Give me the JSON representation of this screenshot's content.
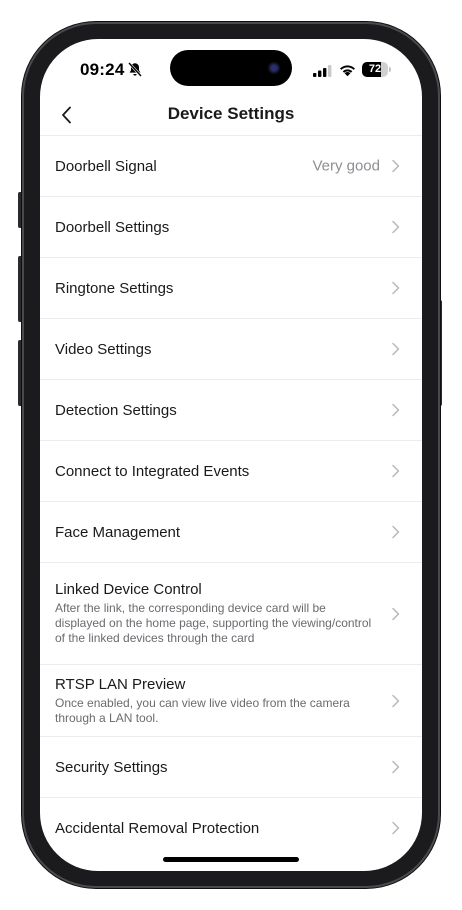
{
  "status_bar": {
    "time": "09:24",
    "battery_level": "72",
    "battery_fraction": 0.72
  },
  "header": {
    "title": "Device Settings"
  },
  "settings": [
    {
      "id": "doorbell-signal",
      "label": "Doorbell Signal",
      "value": "Very good"
    },
    {
      "id": "doorbell-settings",
      "label": "Doorbell Settings"
    },
    {
      "id": "ringtone-settings",
      "label": "Ringtone Settings"
    },
    {
      "id": "video-settings",
      "label": "Video Settings"
    },
    {
      "id": "detection-settings",
      "label": "Detection Settings"
    },
    {
      "id": "connect-integrated-events",
      "label": "Connect to Integrated Events"
    },
    {
      "id": "face-management",
      "label": "Face Management"
    },
    {
      "id": "linked-device-control",
      "label": "Linked Device Control",
      "description": "After the link, the corresponding device card will be displayed on the home page, supporting the viewing/control of the linked devices through the card"
    },
    {
      "id": "rtsp-lan-preview",
      "label": "RTSP LAN Preview",
      "description": "Once enabled, you can view live video from the camera through a LAN tool."
    },
    {
      "id": "security-settings",
      "label": "Security Settings"
    },
    {
      "id": "accidental-removal-protection",
      "label": "Accidental Removal Protection"
    }
  ],
  "colors": {
    "chevron": "#b8b8bd",
    "divider": "#ececee",
    "text": "#1a1a1a",
    "secondary_text": "#8e8e93"
  }
}
